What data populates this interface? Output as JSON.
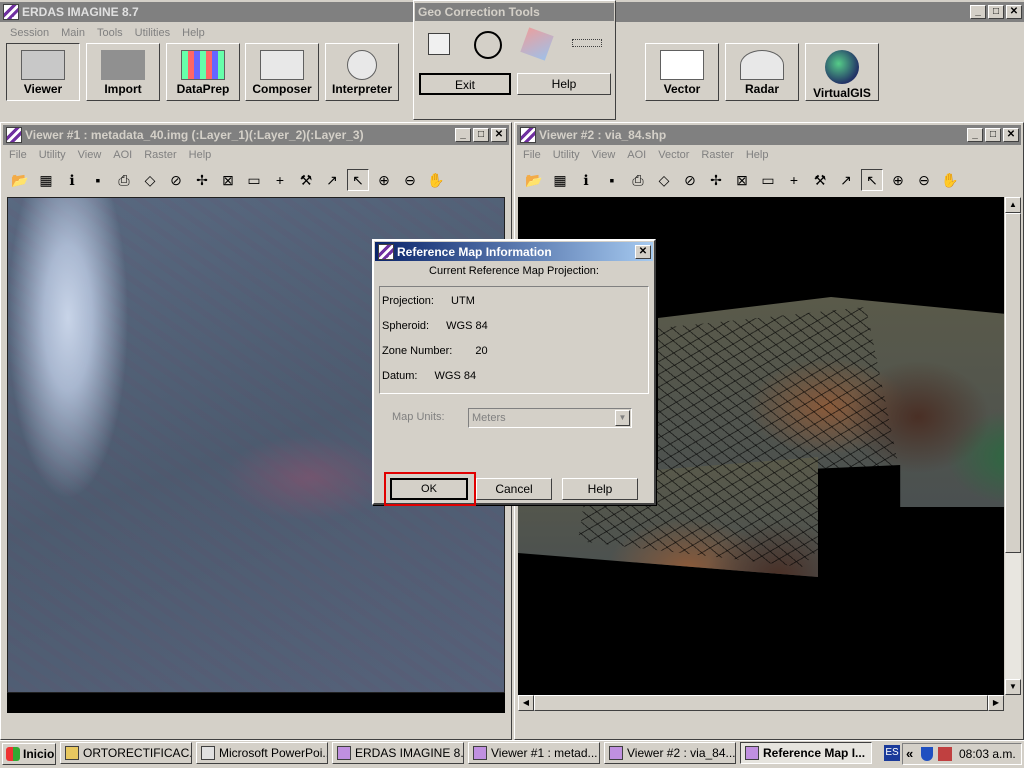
{
  "app": {
    "title": "ERDAS IMAGINE 8.7",
    "menu": [
      "Session",
      "Main",
      "Tools",
      "Utilities",
      "Help"
    ],
    "tools": [
      "Viewer",
      "Import",
      "DataPrep",
      "Composer",
      "Interpreter",
      "Vector",
      "Radar",
      "VirtualGIS"
    ]
  },
  "geo": {
    "title": "Geo Correction Tools",
    "exit": "Exit",
    "help": "Help"
  },
  "viewer1": {
    "title": "Viewer #1 : metadata_40.img (:Layer_1)(:Layer_2)(:Layer_3)",
    "menu": [
      "File",
      "Utility",
      "View",
      "AOI",
      "Raster",
      "Help"
    ]
  },
  "viewer2": {
    "title": "Viewer #2 : via_84.shp",
    "menu": [
      "File",
      "Utility",
      "View",
      "AOI",
      "Vector",
      "Raster",
      "Help"
    ]
  },
  "dialog": {
    "title": "Reference Map Information",
    "subtitle": "Current Reference Map Projection:",
    "rows": [
      {
        "label": "Projection:",
        "value": "UTM"
      },
      {
        "label": "Spheroid:",
        "value": "WGS 84"
      },
      {
        "label": "Zone Number:",
        "value": "20"
      },
      {
        "label": "Datum:",
        "value": "WGS 84"
      }
    ],
    "units_label": "Map Units:",
    "units_value": "Meters",
    "ok": "OK",
    "cancel": "Cancel",
    "help": "Help",
    "close": "✕"
  },
  "taskbar": {
    "start": "Inicio",
    "items": [
      "ORTORECTIFICAC...",
      "Microsoft PowerPoi...",
      "ERDAS IMAGINE 8.7",
      "Viewer #1 : metad...",
      "Viewer #2 : via_84...",
      "Reference Map I..."
    ],
    "lang": "ES",
    "chev": "«",
    "time": "08:03 a.m."
  },
  "winbtns": {
    "min": "_",
    "max": "□",
    "close": "✕"
  }
}
